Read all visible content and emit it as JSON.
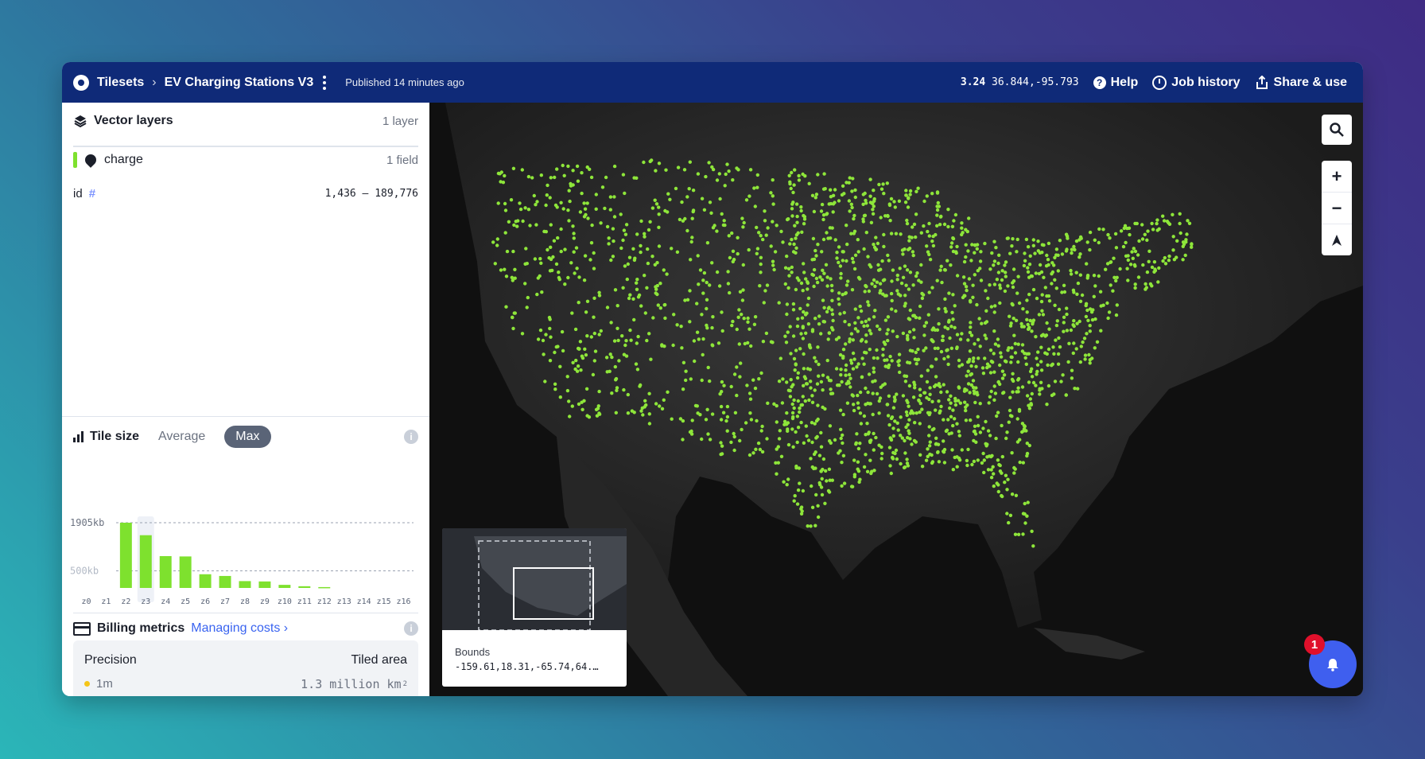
{
  "topbar": {
    "breadcrumb_root": "Tilesets",
    "tileset_name": "EV Charging Stations V3",
    "published": "Published 14 minutes ago",
    "zoom": "3.24",
    "coordinates": "36.844,-95.793",
    "help": "Help",
    "job_history": "Job history",
    "share": "Share & use"
  },
  "vector_layers": {
    "title": "Vector layers",
    "count": "1 layer",
    "layer": {
      "name": "charge",
      "fields": "1 field"
    },
    "field": {
      "name": "id",
      "type_symbol": "#",
      "range": "1,436 – 189,776"
    }
  },
  "tile_size": {
    "title": "Tile size",
    "tabs": [
      "Average",
      "Max"
    ],
    "active_tab": "Max",
    "info": "i"
  },
  "chart_data": {
    "type": "bar",
    "categories": [
      "z0",
      "z1",
      "z2",
      "z3",
      "z4",
      "z5",
      "z6",
      "z7",
      "z8",
      "z9",
      "z10",
      "z11",
      "z12",
      "z13",
      "z14",
      "z15",
      "z16"
    ],
    "values": [
      0,
      0,
      1905,
      1540,
      930,
      920,
      400,
      350,
      200,
      190,
      90,
      50,
      25,
      0,
      0,
      0,
      0
    ],
    "reference_lines": [
      {
        "value": 1905,
        "label": "1905kb"
      },
      {
        "value": 500,
        "label": "500kb"
      }
    ],
    "highlighted_category": "z3",
    "ylim": [
      0,
      1905
    ],
    "bar_color": "#7ee12e"
  },
  "billing": {
    "title": "Billing metrics",
    "link": "Managing costs",
    "precision_label": "Precision",
    "precision_value": "1m",
    "area_label": "Tiled area",
    "area_value": "1.3 million km",
    "area_unit_sup": "2"
  },
  "map": {
    "search_icon": "search-icon",
    "zoom_in": "+",
    "zoom_out": "−",
    "compass": "▲",
    "minimap": {
      "label": "Bounds",
      "value": "-159.61,18.31,-65.74,64.…"
    },
    "notifications": "1",
    "point_color": "#8ee63a"
  }
}
